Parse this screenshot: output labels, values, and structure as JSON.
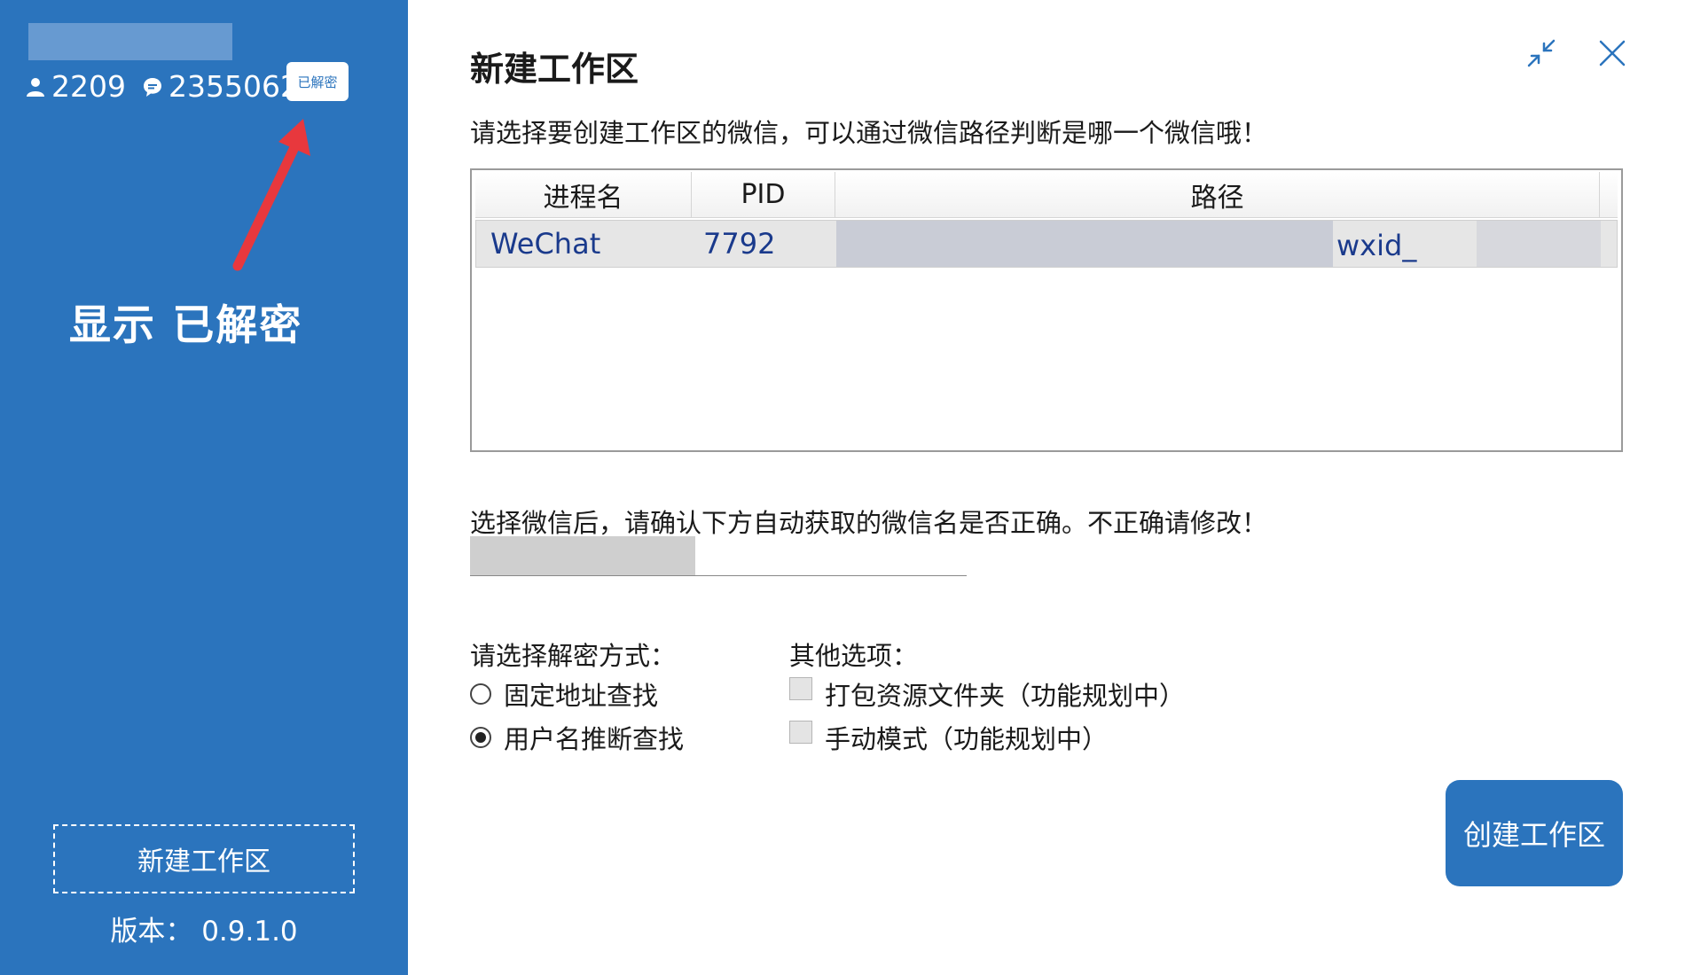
{
  "colors": {
    "accent": "#2B74BD",
    "annotation_arrow": "#E8383D",
    "table_text": "#1A3A8C"
  },
  "sidebar": {
    "user_count": "2209",
    "message_count": "2355062",
    "user_icon": "user-icon",
    "message_icon": "chat-bubble-icon",
    "badge": "已解密",
    "annotation": "显示 已解密",
    "new_workspace_label": "新建工作区",
    "version_label": "版本：",
    "version": "0.9.1.0"
  },
  "dialog": {
    "title": "新建工作区",
    "minimize_icon": "collapse-icon",
    "close_icon": "close-icon",
    "instruction": "请选择要创建工作区的微信，可以通过微信路径判断是哪一个微信哦！",
    "table": {
      "headers": [
        "进程名",
        "PID",
        "路径"
      ],
      "rows": [
        {
          "process": "WeChat",
          "pid": "7792",
          "path_visible": "wxid_"
        }
      ]
    },
    "name_hint": "选择微信后，请确认下方自动获取的微信名是否正确。不正确请修改！",
    "decrypt_label": "请选择解密方式：",
    "decrypt_options": [
      {
        "label": "固定地址查找",
        "selected": false
      },
      {
        "label": "用户名推断查找",
        "selected": true
      }
    ],
    "other_label": "其他选项：",
    "other_options": [
      {
        "label": "打包资源文件夹（功能规划中）",
        "checked": false
      },
      {
        "label": "手动模式（功能规划中）",
        "checked": false
      }
    ],
    "create_button": "创建工作区"
  }
}
